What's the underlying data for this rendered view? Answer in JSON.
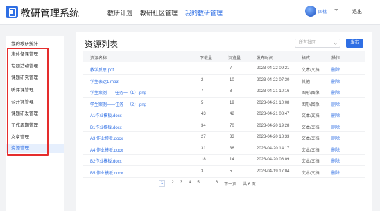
{
  "header": {
    "app_title": "教研管理系统",
    "nav": [
      "教研计划",
      "教研社区管理",
      "我的教研管理"
    ],
    "user_name": "囯桃",
    "logout": "退出"
  },
  "sidebar": {
    "items": [
      {
        "label": "我的教研统计"
      },
      {
        "label": "集体备课管理"
      },
      {
        "label": "专题活动管理"
      },
      {
        "label": "课题研究管理"
      },
      {
        "label": "听评课管理"
      },
      {
        "label": "公开课管理"
      },
      {
        "label": "课题研发管理"
      },
      {
        "label": "工作周期管理"
      },
      {
        "label": "文章管理"
      },
      {
        "label": "资源管理"
      }
    ],
    "active_index": 9
  },
  "main": {
    "title": "资源列表",
    "scope_placeholder": "所有社区",
    "publish_label": "发布",
    "columns": [
      "资源名称",
      "下载量",
      "浏览量",
      "发布时间",
      "格式",
      "操作"
    ],
    "rows": [
      {
        "name": "教学反思.pdf",
        "downloads": "",
        "views": "7",
        "time": "2023-04-22 09:21",
        "format": "文本/文档",
        "action": "删除"
      },
      {
        "name": "学生表达1.mp3",
        "downloads": "2",
        "views": "10",
        "time": "2023-04-22 07:30",
        "format": "其他",
        "action": "删除"
      },
      {
        "name": "学生案例——任务一（1）.png",
        "downloads": "7",
        "views": "8",
        "time": "2023-04-21 10:16",
        "format": "图形/图像",
        "action": "删除"
      },
      {
        "name": "学生案例——任务一（2）.png",
        "downloads": "5",
        "views": "19",
        "time": "2023-04-21 10:08",
        "format": "图形/图像",
        "action": "删除"
      },
      {
        "name": "A1作业模板.docx",
        "downloads": "43",
        "views": "42",
        "time": "2023-04-21 08:47",
        "format": "文本/文档",
        "action": "删除"
      },
      {
        "name": "B1作业模板.docx",
        "downloads": "34",
        "views": "70",
        "time": "2023-04-20 19:28",
        "format": "文本/文档",
        "action": "删除"
      },
      {
        "name": "A3 作业模板.docx",
        "downloads": "27",
        "views": "33",
        "time": "2023-04-20 18:33",
        "format": "文本/文档",
        "action": "删除"
      },
      {
        "name": "A4 作业模板.docx",
        "downloads": "31",
        "views": "36",
        "time": "2023-04-20 14:17",
        "format": "文本/文档",
        "action": "删除"
      },
      {
        "name": "B2作业模板.docx",
        "downloads": "18",
        "views": "14",
        "time": "2023-04-20 08:09",
        "format": "文本/文档",
        "action": "删除"
      },
      {
        "name": "B5 作业模板.docx",
        "downloads": "3",
        "views": "5",
        "time": "2023-04-19 17:04",
        "format": "文本/文档",
        "action": "删除"
      }
    ],
    "pagination": {
      "pages": [
        "1",
        "2",
        "3",
        "4",
        "5"
      ],
      "ellipsis": "...",
      "last": "6",
      "next": "下一页",
      "total": "共 6 页",
      "current": "1"
    }
  },
  "colors": {
    "accent": "#2f6fe4",
    "highlight_box": "#e52d2d",
    "sidebar_active_bg": "#e6effd"
  }
}
